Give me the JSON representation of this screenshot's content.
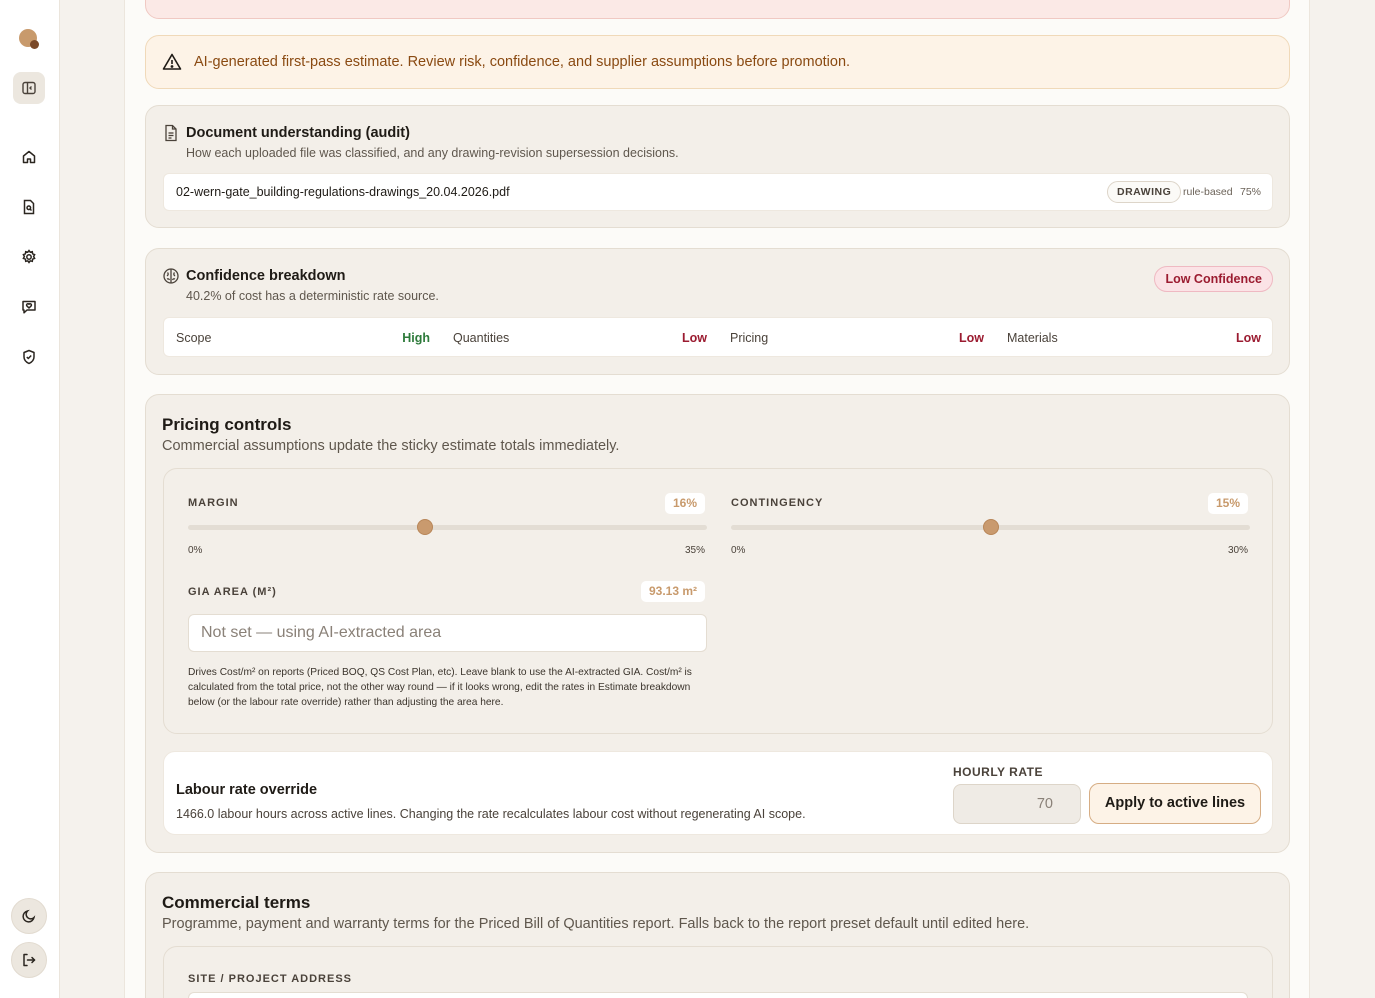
{
  "warning": {
    "text": "AI-generated first-pass estimate. Review risk, confidence, and supplier assumptions before promotion."
  },
  "document_understanding": {
    "title": "Document understanding (audit)",
    "subtitle": "How each uploaded file was classified, and any drawing-revision supersession decisions.",
    "files": [
      {
        "name": "02-wern-gate_building-regulations-drawings_20.04.2026.pdf",
        "type": "DRAWING",
        "method": "rule-based",
        "confidence": "75%"
      }
    ]
  },
  "confidence": {
    "title": "Confidence breakdown",
    "subtitle": "40.2% of cost has a deterministic rate source.",
    "badge": "Low Confidence",
    "items": [
      {
        "label": "Scope",
        "value": "High"
      },
      {
        "label": "Quantities",
        "value": "Low"
      },
      {
        "label": "Pricing",
        "value": "Low"
      },
      {
        "label": "Materials",
        "value": "Low"
      }
    ]
  },
  "pricing": {
    "title": "Pricing controls",
    "subtitle": "Commercial assumptions update the sticky estimate totals immediately.",
    "margin": {
      "label": "MARGIN",
      "value_text": "16%",
      "value": 16,
      "min_text": "0%",
      "max_text": "35%",
      "min": 0,
      "max": 35
    },
    "contingency": {
      "label": "CONTINGENCY",
      "value_text": "15%",
      "value": 15,
      "min_text": "0%",
      "max_text": "30%",
      "min": 0,
      "max": 30
    },
    "gia": {
      "label": "GIA AREA (M²)",
      "value_text": "93.13 m²",
      "placeholder": "Not set — using AI-extracted area",
      "help": "Drives Cost/m² on reports (Priced BOQ, QS Cost Plan, etc). Leave blank to use the AI-extracted GIA. Cost/m² is calculated from the total price, not the other way round — if it looks wrong, edit the rates in Estimate breakdown below (or the labour rate override) rather than adjusting the area here."
    },
    "labour": {
      "title": "Labour rate override",
      "subtitle": "1466.0 labour hours across active lines. Changing the rate recalculates labour cost without regenerating AI scope.",
      "rate_label": "HOURLY RATE",
      "rate_placeholder": "70",
      "apply_label": "Apply to active lines"
    }
  },
  "terms": {
    "title": "Commercial terms",
    "subtitle": "Programme, payment and warranty terms for the Priced Bill of Quantities report. Falls back to the report preset default until edited here.",
    "site_label": "SITE / PROJECT ADDRESS"
  },
  "icons": {
    "logo": "brand-logo",
    "sidebar": [
      "sidebar-toggle-icon",
      "home-icon",
      "document-search-icon",
      "gear-icon",
      "chat-icon",
      "shield-check-icon",
      "moon-icon",
      "logout-icon"
    ]
  },
  "colors": {
    "accent": "#c89a6c",
    "high": "#2d7a3a",
    "low": "#9b1b30",
    "warning_text": "#8a4a12"
  }
}
